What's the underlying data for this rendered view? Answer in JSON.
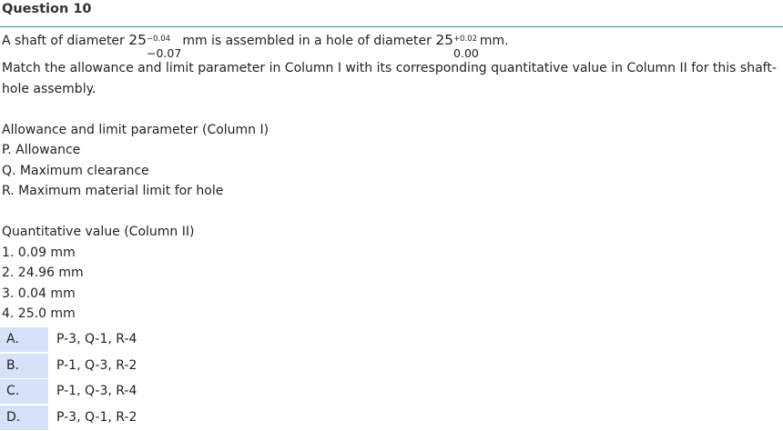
{
  "header": {
    "title": "Question 10"
  },
  "question": {
    "line1": {
      "prefix": "A shaft of diameter ",
      "shaft_base": "25",
      "shaft_upper": "−0.04",
      "shaft_lower": "−0.07",
      "middle": "mm is assembled in a hole of diameter ",
      "hole_base": "25",
      "hole_upper": "+0.02",
      "hole_lower": "0.00",
      "suffix": "mm."
    },
    "line2": "Match the allowance and limit parameter in Column I with its corresponding quantitative value in Column II for this shaft-hole assembly."
  },
  "column1": {
    "heading": "Allowance and limit parameter (Column I)",
    "items": [
      "P. Allowance",
      "Q. Maximum clearance",
      "R. Maximum material limit for hole"
    ]
  },
  "column2": {
    "heading": "Quantitative value (Column II)",
    "items": [
      "1. 0.09 mm",
      "2. 24.96 mm",
      "3. 0.04 mm",
      "4. 25.0 mm"
    ]
  },
  "options": [
    {
      "letter": "A.",
      "text": "P-3, Q-1, R-4"
    },
    {
      "letter": "B.",
      "text": "P-1, Q-3, R-2"
    },
    {
      "letter": "C.",
      "text": "P-1, Q-3, R-4"
    },
    {
      "letter": "D.",
      "text": "P-3, Q-1, R-2"
    }
  ],
  "colors": {
    "header_rule": "#2f93b8",
    "option_letter_bg": "#d6e2f8"
  }
}
